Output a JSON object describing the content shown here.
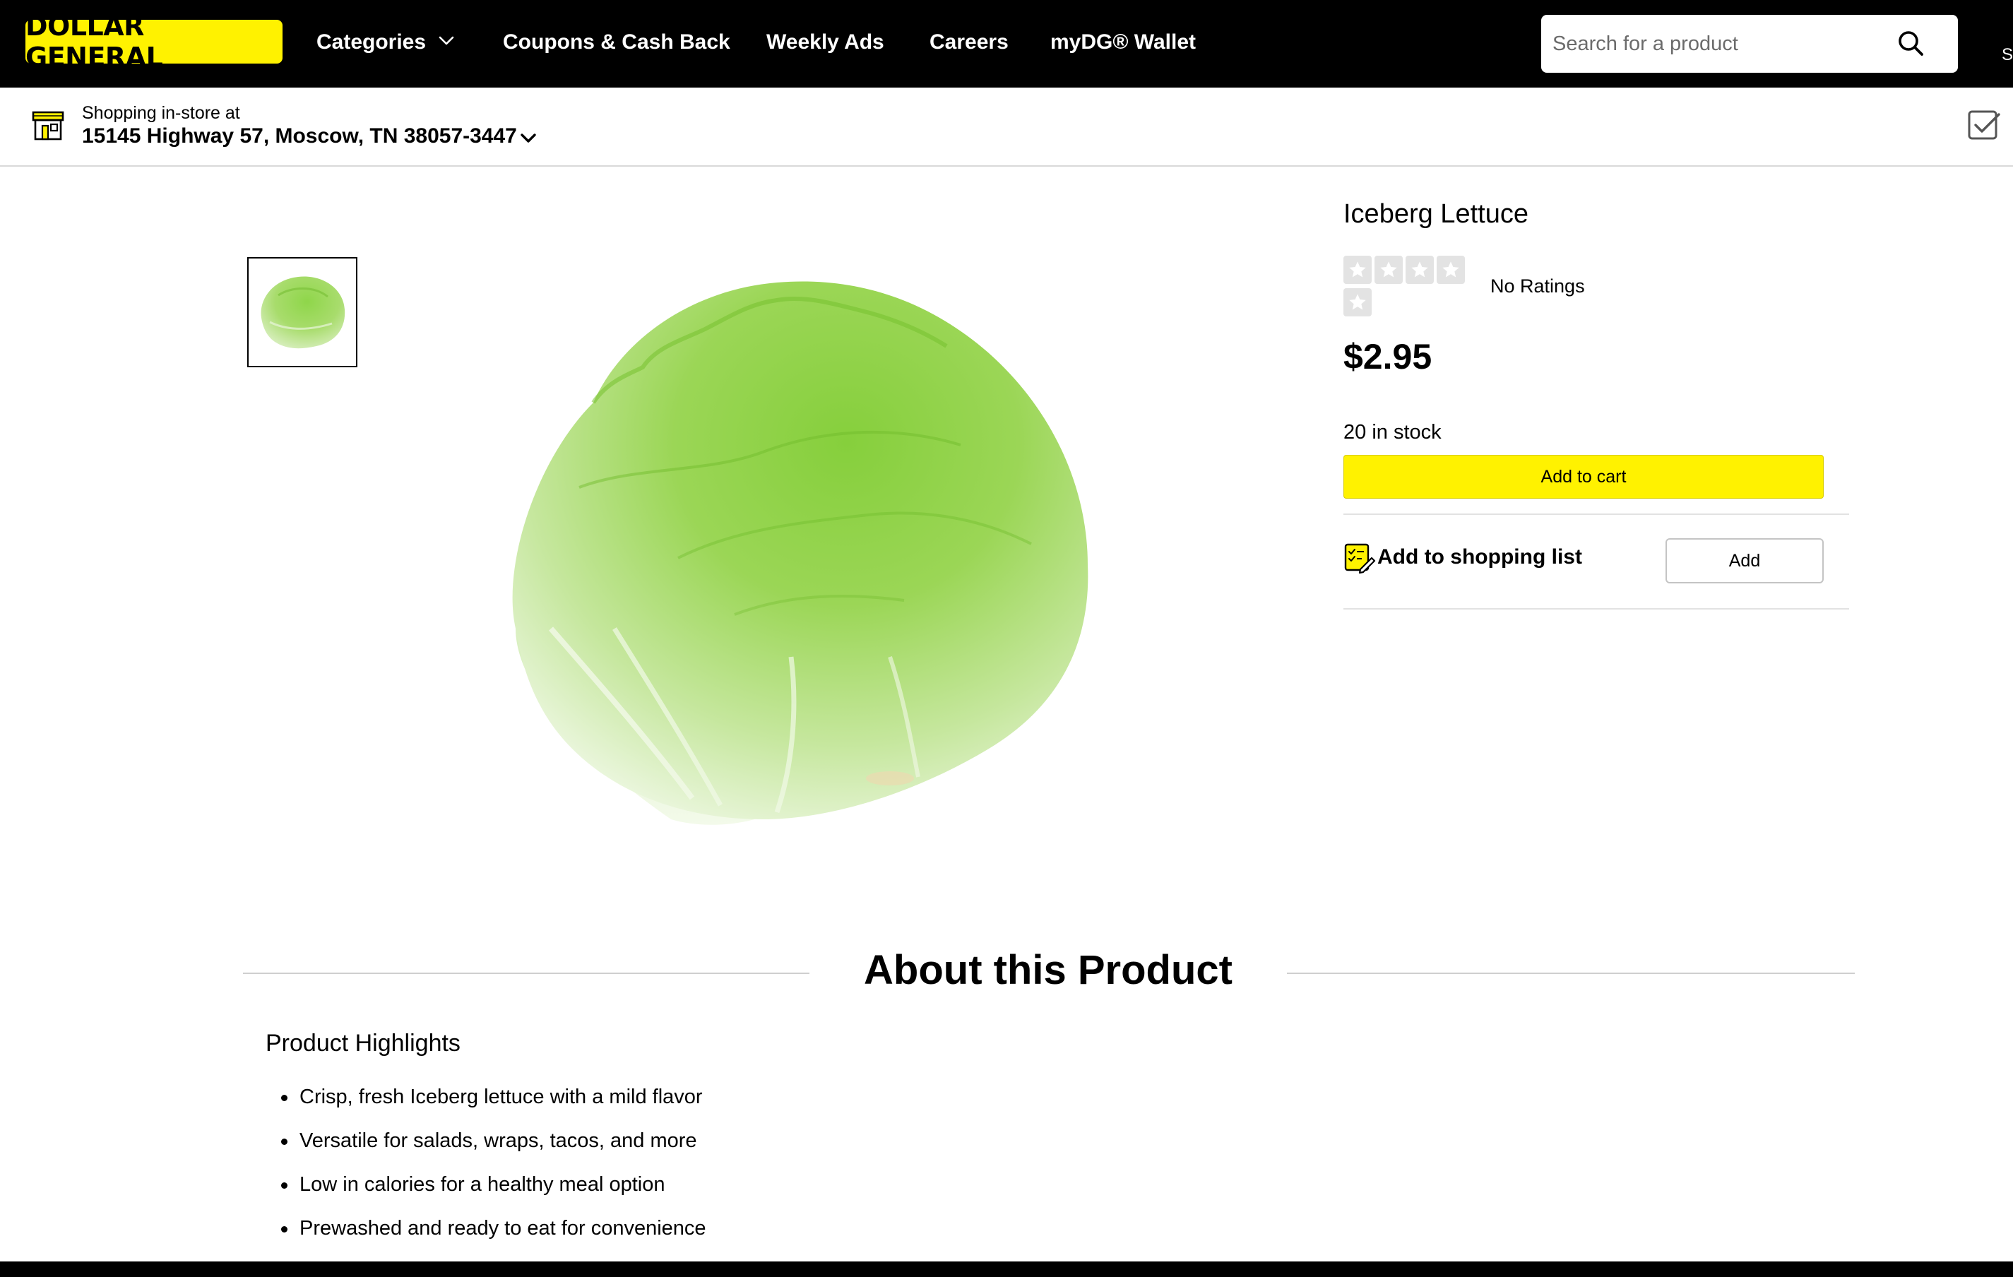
{
  "header": {
    "logo_text": "DOLLAR GENERAL",
    "nav": {
      "categories": "Categories",
      "coupons": "Coupons & Cash Back",
      "weekly_ads": "Weekly Ads",
      "careers": "Careers",
      "wallet": "myDG® Wallet"
    },
    "search_placeholder": "Search for a product",
    "edge_text": "S"
  },
  "store": {
    "label": "Shopping in-store at",
    "address": "15145 Highway 57, Moscow, TN 38057-3447"
  },
  "product": {
    "title": "Iceberg Lettuce",
    "rating_text": "No Ratings",
    "rating": 0,
    "rating_max": 5,
    "price": "$2.95",
    "stock": "20 in stock",
    "add_to_cart": "Add to cart",
    "shopping_list_label": "Add to shopping list",
    "add_button": "Add"
  },
  "about": {
    "title": "About this Product",
    "highlights_title": "Product Highlights",
    "highlights": [
      "Crisp, fresh Iceberg lettuce with a mild flavor",
      "Versatile for salads, wraps, tacos, and more",
      "Low in calories for a healthy meal option",
      "Prewashed and ready to eat for convenience"
    ]
  },
  "colors": {
    "brand_yellow": "#fff200",
    "nav_background": "#000000"
  },
  "icons": {
    "categories_chevron": "chevron-down-icon",
    "search": "search-icon",
    "store": "store-icon",
    "store_chevron": "chevron-down-icon",
    "shopping_list": "checklist-icon",
    "star": "star-icon"
  }
}
